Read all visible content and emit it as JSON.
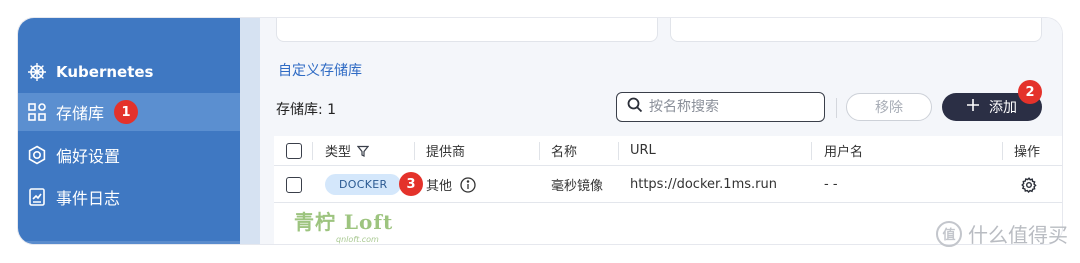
{
  "sidebar": {
    "items": [
      {
        "label": "Kubernetes",
        "icon": "kubernetes-helm-icon"
      },
      {
        "label": "存储库",
        "icon": "repository-grid-icon",
        "active": true,
        "marker": "1"
      },
      {
        "label": "偏好设置",
        "icon": "gear-icon"
      },
      {
        "label": "事件日志",
        "icon": "log-document-icon"
      }
    ]
  },
  "main": {
    "section_title": "自定义存储库",
    "count_label": "存储库: 1",
    "search": {
      "placeholder": "按名称搜索",
      "value": ""
    },
    "remove_label": "移除",
    "add_label": "添加",
    "add_marker": "2"
  },
  "table": {
    "columns": [
      "类型",
      "提供商",
      "名称",
      "URL",
      "用户名",
      "操作"
    ],
    "rows": [
      {
        "type": "DOCKER",
        "type_marker": "3",
        "provider": "其他",
        "name": "毫秒镜像",
        "url": "https://docker.1ms.run",
        "username": "- -"
      }
    ]
  },
  "watermark": {
    "main": "青柠 Loft",
    "sub": "qnloft.com"
  },
  "site_logo": {
    "symbol": "值",
    "text": "什么值得买"
  },
  "colors": {
    "sidebar": "#3f78c2",
    "sidebar_active": "#5b8fd0",
    "accent": "#2f6bc4",
    "marker": "#e4322b",
    "add_button": "#2b2f45",
    "docker_tag": "#d4e7fb"
  }
}
